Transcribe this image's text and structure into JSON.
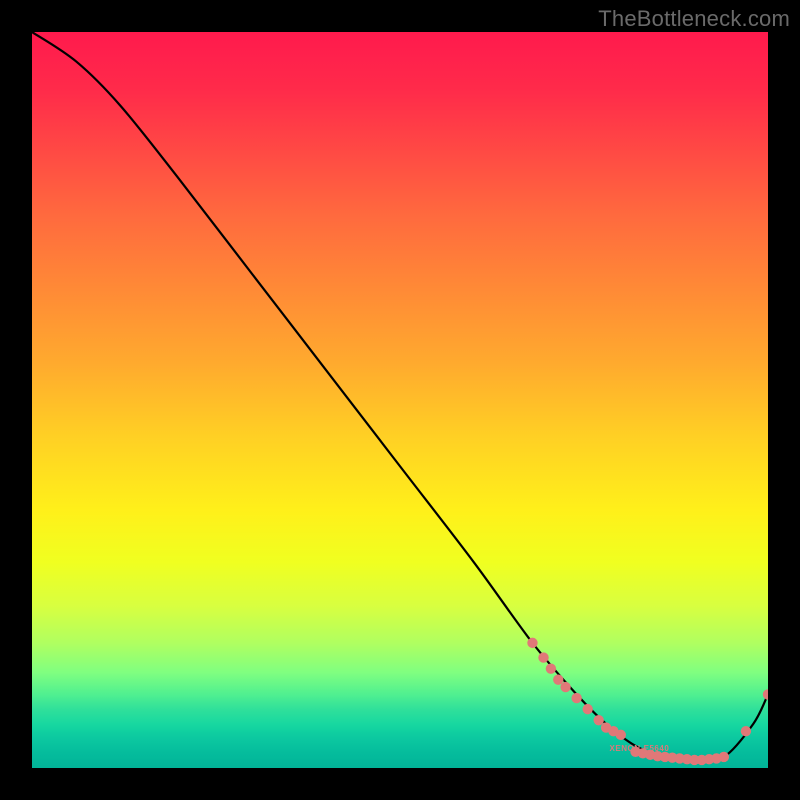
{
  "watermark": "TheBottleneck.com",
  "chart_data": {
    "type": "line",
    "title": "",
    "xlabel": "",
    "ylabel": "",
    "xlim": [
      0,
      100
    ],
    "ylim": [
      0,
      100
    ],
    "series": [
      {
        "name": "bottleneck-curve",
        "x": [
          0,
          6,
          12,
          20,
          30,
          40,
          50,
          60,
          68,
          74,
          78,
          82,
          86,
          90,
          94,
          98,
          100
        ],
        "y": [
          100,
          96,
          90,
          80,
          67,
          54,
          41,
          28,
          17,
          10,
          6,
          3,
          1.5,
          1,
          1.5,
          6,
          10
        ]
      }
    ],
    "scatter_points": {
      "name": "highlighted-points",
      "color": "#e07878",
      "points": [
        {
          "x": 68,
          "y": 17
        },
        {
          "x": 69.5,
          "y": 15
        },
        {
          "x": 70.5,
          "y": 13.5
        },
        {
          "x": 71.5,
          "y": 12
        },
        {
          "x": 72.5,
          "y": 11
        },
        {
          "x": 74,
          "y": 9.5
        },
        {
          "x": 75.5,
          "y": 8
        },
        {
          "x": 77,
          "y": 6.5
        },
        {
          "x": 78,
          "y": 5.5
        },
        {
          "x": 79,
          "y": 5
        },
        {
          "x": 80,
          "y": 4.5
        },
        {
          "x": 82,
          "y": 2.2
        },
        {
          "x": 83,
          "y": 2
        },
        {
          "x": 84,
          "y": 1.8
        },
        {
          "x": 85,
          "y": 1.6
        },
        {
          "x": 86,
          "y": 1.5
        },
        {
          "x": 87,
          "y": 1.4
        },
        {
          "x": 88,
          "y": 1.3
        },
        {
          "x": 89,
          "y": 1.2
        },
        {
          "x": 90,
          "y": 1.1
        },
        {
          "x": 91,
          "y": 1.1
        },
        {
          "x": 92,
          "y": 1.2
        },
        {
          "x": 93,
          "y": 1.3
        },
        {
          "x": 94,
          "y": 1.5
        },
        {
          "x": 97,
          "y": 5
        },
        {
          "x": 100,
          "y": 10
        }
      ]
    },
    "micro_label": {
      "text": "XENON-E5640",
      "x": 82,
      "y": 2.5
    }
  },
  "colors": {
    "curve": "#000000",
    "marker": "#e07878",
    "watermark": "#6a6a6a"
  }
}
